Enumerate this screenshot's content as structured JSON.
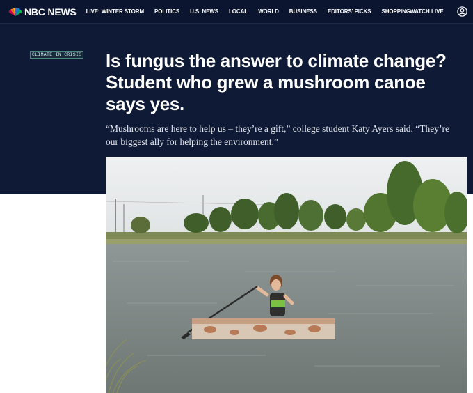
{
  "brand": {
    "name": "NBC NEWS"
  },
  "nav": {
    "items": [
      {
        "label": "LIVE: WINTER STORM"
      },
      {
        "label": "POLITICS"
      },
      {
        "label": "U.S. NEWS"
      },
      {
        "label": "LOCAL"
      },
      {
        "label": "WORLD"
      },
      {
        "label": "BUSINESS"
      },
      {
        "label": "EDITORS' PICKS"
      },
      {
        "label": "SHOPPING"
      }
    ],
    "watch_live": "WATCH LIVE"
  },
  "article": {
    "tag": "CLIMATE IN CRISIS",
    "headline": "Is fungus the answer to climate change? Student who grew a mushroom canoe says yes.",
    "dek": "“Mushrooms are here to help us – they’re a gift,” college student Katy Ayers said. “They’re our biggest ally for helping the environment.”"
  },
  "colors": {
    "nav_bg": "#0b1530",
    "hero_bg": "#0f1a36",
    "tag_border": "#4c8a79"
  },
  "icons": {
    "logo": "nbc-peacock-icon",
    "account": "user-circle-icon"
  }
}
